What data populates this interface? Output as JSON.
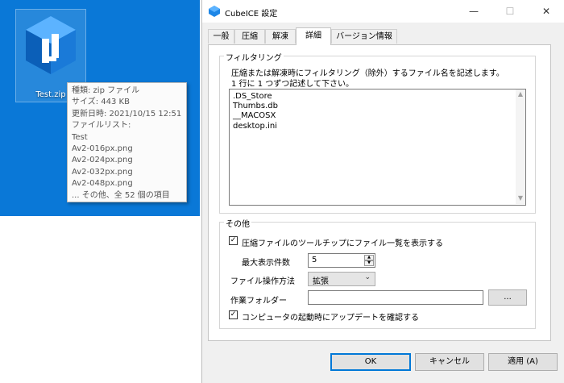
{
  "desktop": {
    "file_name": "Test.zip",
    "tooltip_lines": [
      "種類: zip ファイル",
      "サイズ: 443 KB",
      "更新日時: 2021/10/15 12:51",
      "ファイルリスト:",
      "Test",
      "Av2-016px.png",
      "Av2-024px.png",
      "Av2-032px.png",
      "Av2-048px.png",
      "... その他、全 52 個の項目"
    ]
  },
  "window": {
    "title": "CubeICE 設定",
    "minimize": "—",
    "maximize": "☐",
    "close": "✕"
  },
  "tabs": [
    "一般",
    "圧縮",
    "解凍",
    "詳細",
    "バージョン情報"
  ],
  "active_tab": "詳細",
  "filtering": {
    "title": "フィルタリング",
    "desc1": "圧縮または解凍時にフィルタリング（除外）するファイル名を記述します。",
    "desc2": "1 行に 1 つずつ記述して下さい。",
    "lines": [
      ".DS_Store",
      "Thumbs.db",
      "__MACOSX",
      "desktop.ini"
    ]
  },
  "other": {
    "title": "その他",
    "tooltip_filelist_label": "圧縮ファイルのツールチップにファイル一覧を表示する",
    "tooltip_filelist_checked": true,
    "max_count_label": "最大表示件数",
    "max_count_value": "5",
    "file_op_label": "ファイル操作方法",
    "file_op_value": "拡張",
    "work_folder_label": "作業フォルダー",
    "work_folder_value": "",
    "browse_label": "...",
    "update_check_label": "コンピュータの起動時にアップデートを確認する",
    "update_check_checked": true
  },
  "buttons": {
    "ok": "OK",
    "cancel": "キャンセル",
    "apply": "適用 (A)"
  },
  "colors": {
    "desktop": "#0a78d7",
    "accent": "#0078d7"
  }
}
